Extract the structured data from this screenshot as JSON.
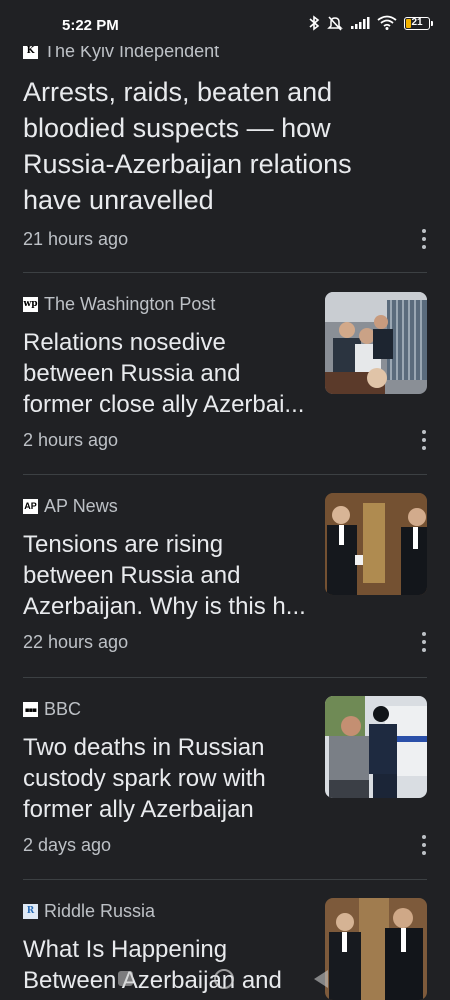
{
  "status_bar": {
    "time": "5:22 PM",
    "battery_level": "21",
    "icons": [
      "bluetooth-icon",
      "mute-icon",
      "signal-icon",
      "wifi-icon",
      "battery-icon"
    ]
  },
  "articles": [
    {
      "source": "The Kyiv Independent",
      "logo_text": "K",
      "headline": "Arrests, raids, beaten and bloodied suspects — how Russia-Azerbaijan relations have unravelled",
      "time": "21 hours ago",
      "has_thumbnail": false
    },
    {
      "source": "The Washington Post",
      "logo_text": "wp",
      "headline": "Relations nosedive between Russia and former close ally Azerbai...",
      "time": "2 hours ago",
      "has_thumbnail": true
    },
    {
      "source": "AP News",
      "logo_text": "AP",
      "headline": "Tensions are rising between Russia and Azerbaijan. Why is this h...",
      "time": "22 hours ago",
      "has_thumbnail": true
    },
    {
      "source": "BBC",
      "logo_text": "▪▪▪",
      "headline": "Two deaths in Russian custody spark row with former ally Azerbaijan",
      "time": "2 days ago",
      "has_thumbnail": true
    },
    {
      "source": "Riddle Russia",
      "logo_text": "R",
      "headline": "What Is Happening Between Azerbaijan and",
      "time": "",
      "has_thumbnail": true
    }
  ],
  "colors": {
    "background": "#202124",
    "text_primary": "#e8eaed",
    "text_secondary": "#bdc1c6",
    "divider": "#3c4043",
    "battery_accent": "#f4b400"
  }
}
